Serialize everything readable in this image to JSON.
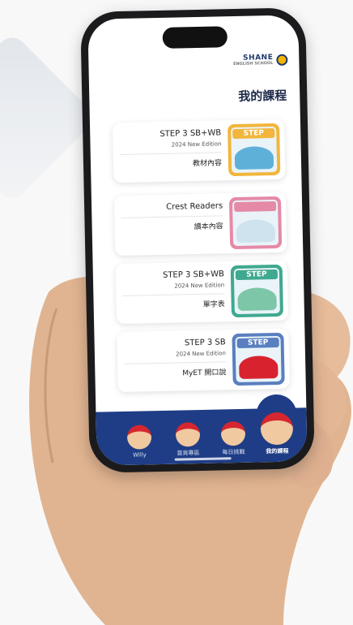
{
  "app": {
    "brand": "SHANE",
    "brand_sub": "ENGLISH SCHOOL",
    "page_title": "我的課程"
  },
  "courses": [
    {
      "name": "STEP 3 SB+WB",
      "edition": "2024 New Edition",
      "type": "教材內容",
      "cover_label": "STEP",
      "cover_color": "#f2b63c",
      "scene_color": "#5fb0d9"
    },
    {
      "name": "Crest Readers",
      "edition": "",
      "type": "讀本內容",
      "cover_label": "",
      "cover_color": "#e58aa6",
      "scene_color": "#cfe3ef"
    },
    {
      "name": "STEP 3 SB+WB",
      "edition": "2024 New Edition",
      "type": "單字表",
      "cover_label": "STEP",
      "cover_color": "#3fa98f",
      "scene_color": "#7dc6a8"
    },
    {
      "name": "STEP 3 SB",
      "edition": "2024 New Edition",
      "type": "MyET 開口說",
      "cover_label": "STEP",
      "cover_color": "#5a7fc0",
      "scene_color": "#d8232f"
    }
  ],
  "tabs": [
    {
      "label": "我的課程",
      "active": true
    },
    {
      "label": "每日挑戰",
      "active": false
    },
    {
      "label": "首頁專區",
      "active": false
    },
    {
      "label": "Willy",
      "active": false
    }
  ],
  "colors": {
    "tabbar": "#1e3d86",
    "title": "#1e2a4a",
    "mascot_cap": "#d6262f"
  }
}
